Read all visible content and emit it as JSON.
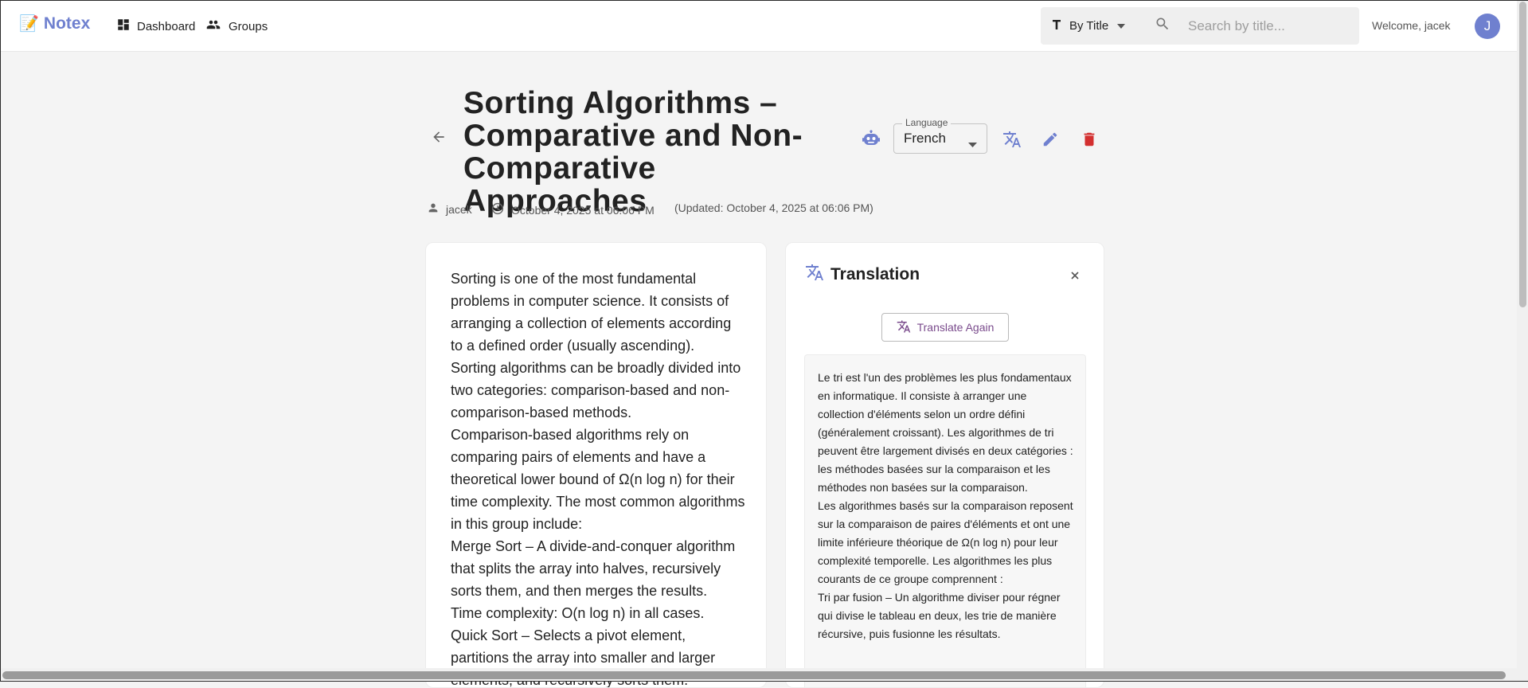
{
  "app": {
    "logo_emoji": "📝",
    "name": "Notex",
    "brand_color": "#6f80cf"
  },
  "nav": {
    "dashboard": "Dashboard",
    "groups": "Groups"
  },
  "sort": {
    "label": "By Title"
  },
  "search": {
    "placeholder": "Search by title..."
  },
  "user": {
    "welcome": "Welcome, jacek",
    "avatar_letter": "J"
  },
  "note": {
    "title": "Sorting Algorithms – Comparative and Non-Comparative Approaches",
    "author": "jacek",
    "created": "October 4, 2025 at 06:06 PM",
    "updated": "(Updated: October 4, 2025 at 06:06 PM)",
    "language_label": "Language",
    "language_value": "French",
    "paragraphs": [
      "Sorting is one of the most fundamental problems in computer science. It consists of arranging a collection of elements according to a defined order (usually ascending).",
      "Sorting algorithms can be broadly divided into two categories: comparison-based and non-comparison-based methods.",
      "Comparison-based algorithms rely on comparing pairs of elements and have a theoretical lower bound of Ω(n log n) for their time complexity. The most common algorithms in this group include:",
      "Merge Sort – A divide-and-conquer algorithm that splits the array into halves, recursively sorts them, and then merges the results.",
      "Time complexity: O(n log n) in all cases.",
      "Quick Sort – Selects a pivot element, partitions the array into smaller and larger elements, and recursively sorts them."
    ]
  },
  "translation": {
    "title": "Translation",
    "translate_again": "Translate Again",
    "paragraphs": [
      "Le tri est l'un des problèmes les plus fondamentaux en informatique. Il consiste à arranger une collection d'éléments selon un ordre défini (généralement croissant). Les algorithmes de tri peuvent être largement divisés en deux catégories : les méthodes basées sur la comparaison et les méthodes non basées sur la comparaison.",
      "Les algorithmes basés sur la comparaison reposent sur la comparaison de paires d'éléments et ont une limite inférieure théorique de Ω(n log n) pour leur complexité temporelle. Les algorithmes les plus courants de ce groupe comprennent :",
      "Tri par fusion – Un algorithme diviser pour régner qui divise le tableau en deux, les trie de manière récursive, puis fusionne les résultats."
    ]
  },
  "colors": {
    "accent": "#6f80cf",
    "delete": "#d32f2f",
    "translate_again_text": "#7a4b8c"
  },
  "icons": {
    "dashboard": "dashboard-icon",
    "groups": "groups-icon",
    "sort": "text-format-icon",
    "search": "search-icon",
    "back": "arrow-back-icon",
    "robot": "robot-icon",
    "translate": "translate-icon",
    "edit": "edit-icon",
    "delete": "delete-icon",
    "person": "person-icon",
    "clock": "clock-icon",
    "close": "close-icon"
  }
}
